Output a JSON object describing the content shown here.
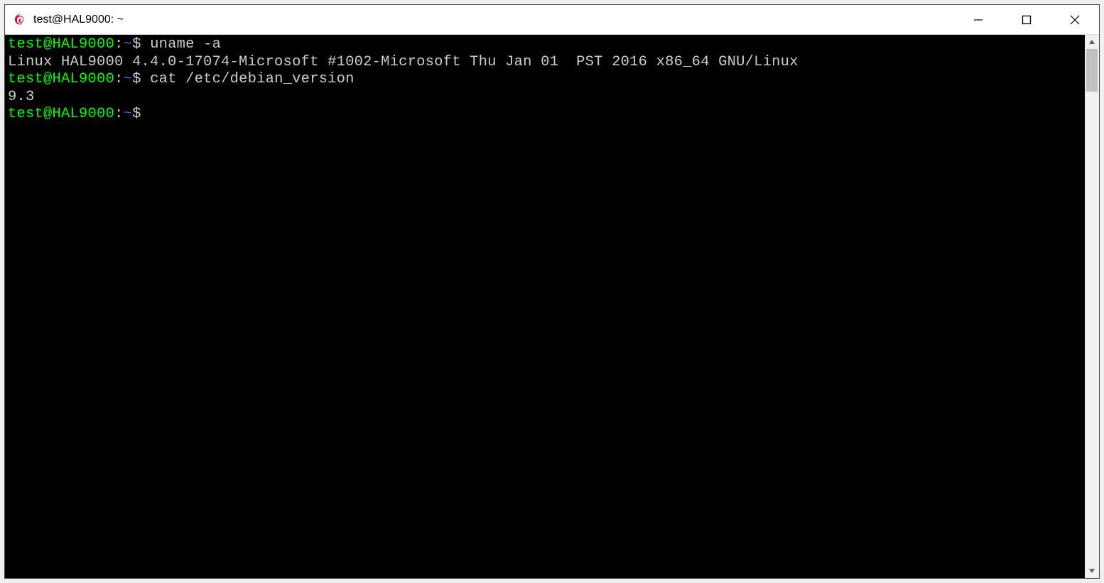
{
  "window": {
    "title": "test@HAL9000: ~"
  },
  "terminal": {
    "lines": [
      {
        "prompt_user": "test@HAL9000",
        "prompt_sep": ":",
        "prompt_path": "~",
        "prompt_symbol": "$ ",
        "command": "uname -a"
      },
      {
        "output": "Linux HAL9000 4.4.0-17074-Microsoft #1002-Microsoft Thu Jan 01  PST 2016 x86_64 GNU/Linux"
      },
      {
        "prompt_user": "test@HAL9000",
        "prompt_sep": ":",
        "prompt_path": "~",
        "prompt_symbol": "$ ",
        "command": "cat /etc/debian_version"
      },
      {
        "output": "9.3"
      },
      {
        "prompt_user": "test@HAL9000",
        "prompt_sep": ":",
        "prompt_path": "~",
        "prompt_symbol": "$ ",
        "command": ""
      }
    ]
  }
}
